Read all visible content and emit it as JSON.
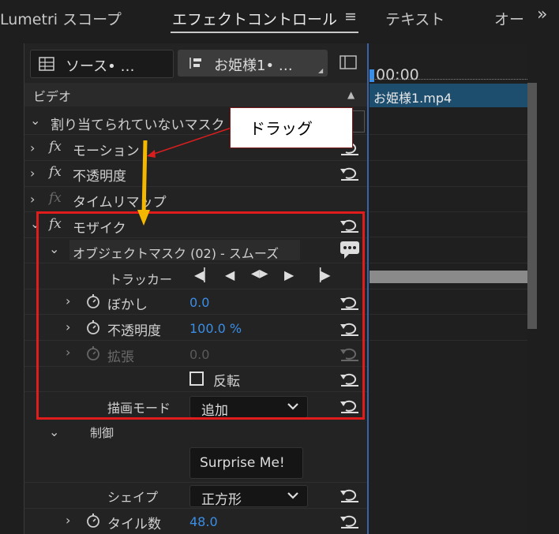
{
  "tabs": [
    {
      "label": "Lumetri スコープ",
      "active": false
    },
    {
      "label": "エフェクトコントロール",
      "active": true
    },
    {
      "label": "テキスト",
      "active": false
    },
    {
      "label": "オー",
      "active": false
    }
  ],
  "tab_menu_icon": "≡",
  "overflow_icon": "»",
  "source_selector": "ソース• …",
  "clip_selector": "お姫様1• …",
  "timeline": {
    "timecode": "00:00",
    "clip_name": "お姫様1.mp4"
  },
  "section_video": "ビデオ",
  "unassigned_mask": "割り当てられていないマスク",
  "effects": {
    "motion": "モーション",
    "opacity": "不透明度",
    "time_remap": "タイムリマップ",
    "mosaic": "モザイク"
  },
  "object_mask": "オブジェクトマスク (02) - スムーズ",
  "tracker_label": "トラッカー",
  "mask_params": {
    "blur_label": "ぼかし",
    "blur_value": "0.0",
    "opacity_label": "不透明度",
    "opacity_value": "100.0 %",
    "expand_label": "拡張",
    "expand_value": "0.0",
    "invert_label": "反転",
    "blend_label": "描画モード",
    "blend_value": "追加"
  },
  "control": {
    "group_label": "制御",
    "surprise_button": "Surprise Me!",
    "shape_label": "シェイプ",
    "shape_value": "正方形",
    "tiles_label": "タイル数",
    "tiles_value": "48.0"
  },
  "annotation": "ドラッグ",
  "colors": {
    "accent_blue": "#3a8ee6",
    "highlight_red": "#e01c1c",
    "drag_arrow": "#f5b800",
    "clip_bar": "#1d4e6e"
  }
}
